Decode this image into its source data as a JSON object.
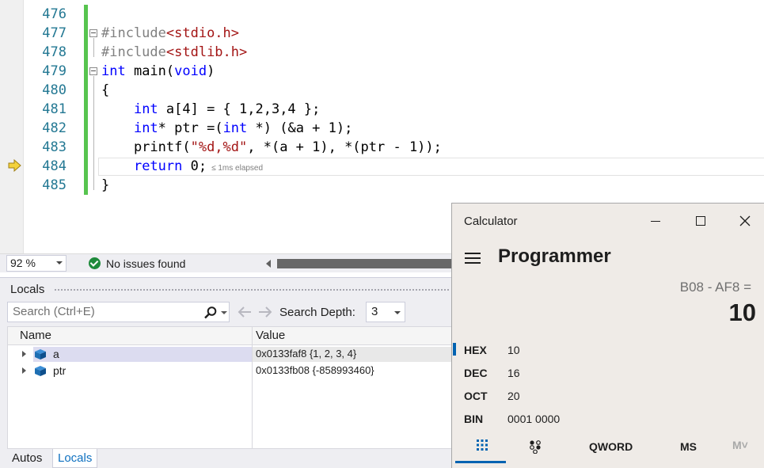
{
  "editor": {
    "lines": [
      {
        "number": "476"
      },
      {
        "number": "477",
        "code": [
          {
            "t": "#include",
            "c": "pp"
          },
          {
            "t": "<stdio.h>",
            "c": "inc"
          }
        ]
      },
      {
        "number": "478",
        "code": [
          {
            "t": "#include",
            "c": "pp"
          },
          {
            "t": "<stdlib.h>",
            "c": "inc"
          }
        ]
      },
      {
        "number": "479",
        "code": [
          {
            "t": "int",
            "c": "kw"
          },
          {
            "t": " main("
          },
          {
            "t": "void",
            "c": "kw"
          },
          {
            "t": ")"
          }
        ]
      },
      {
        "number": "480",
        "code": [
          {
            "t": "{"
          }
        ]
      },
      {
        "number": "481",
        "code": [
          {
            "t": "    "
          },
          {
            "t": "int",
            "c": "kw"
          },
          {
            "t": " a[4] = { 1,2,3,4 };"
          }
        ]
      },
      {
        "number": "482",
        "code": [
          {
            "t": "    "
          },
          {
            "t": "int",
            "c": "kw"
          },
          {
            "t": "* ptr =("
          },
          {
            "t": "int",
            "c": "kw"
          },
          {
            "t": " *) (&a + 1);"
          }
        ]
      },
      {
        "number": "483",
        "code": [
          {
            "t": "    printf("
          },
          {
            "t": "\"%d,%d\"",
            "c": "str"
          },
          {
            "t": ", *(a + 1), *(ptr - 1));"
          }
        ]
      },
      {
        "number": "484",
        "code": [
          {
            "t": "    "
          },
          {
            "t": "return",
            "c": "kw"
          },
          {
            "t": " 0;"
          }
        ],
        "perf_tip": "≤ 1ms elapsed"
      },
      {
        "number": "485",
        "code": [
          {
            "t": "}"
          }
        ]
      }
    ]
  },
  "status_bar": {
    "zoom": "92 %",
    "issues": "No issues found"
  },
  "locals": {
    "title": "Locals",
    "search_placeholder": "Search (Ctrl+E)",
    "depth_label": "Search Depth:",
    "depth_value": "3",
    "columns": {
      "name": "Name",
      "value": "Value"
    },
    "rows": [
      {
        "name": "a",
        "value": "0x0133faf8 {1, 2, 3, 4}"
      },
      {
        "name": "ptr",
        "value": "0x0133fb08 {-858993460}"
      }
    ],
    "tabs": {
      "autos": "Autos",
      "locals": "Locals"
    }
  },
  "calculator": {
    "title": "Calculator",
    "mode": "Programmer",
    "expression": "B08 - AF8 =",
    "result": "10",
    "bases": [
      {
        "name": "HEX",
        "value": "10"
      },
      {
        "name": "DEC",
        "value": "16"
      },
      {
        "name": "OCT",
        "value": "20"
      },
      {
        "name": "BIN",
        "value": "0001 0000"
      }
    ],
    "word_size": "QWORD",
    "memory_store": "MS",
    "memory_list": "M˅"
  },
  "colors": {
    "keyword": "#0000ff",
    "string": "#a31515",
    "preprocessor": "#808080",
    "line_number": "#237893",
    "change_bar": "#57c44f",
    "calc_accent": "#0063b1"
  }
}
